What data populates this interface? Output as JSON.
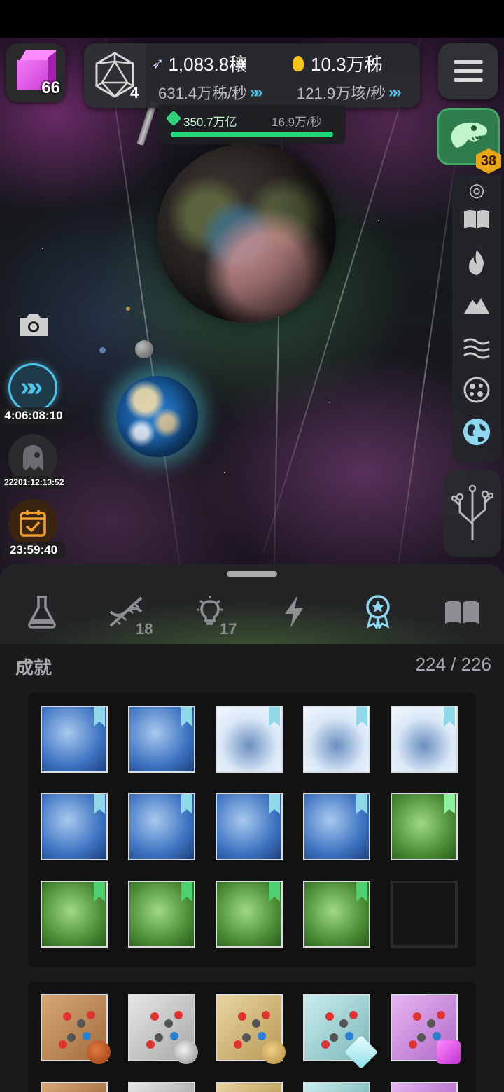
{
  "hud": {
    "gem_count": "66",
    "d20_level": "4",
    "resource_a": {
      "value": "1,083.8穰",
      "rate": "631.4万秭/秒"
    },
    "resource_b": {
      "value": "10.3万秭",
      "rate": "121.9万垓/秒"
    },
    "biomass": {
      "value": "350.7万亿",
      "rate": "16.9万/秒",
      "progress_pct": 100
    },
    "dino_badge": "38"
  },
  "left_timers": {
    "boost": "4:06:08:10",
    "ghost": "22201:12:13:52",
    "calendar": "23:59:40"
  },
  "tabs": [
    {
      "name": "flask",
      "count": ""
    },
    {
      "name": "dna",
      "count": "18"
    },
    {
      "name": "idea",
      "count": "17"
    },
    {
      "name": "bolt",
      "count": ""
    },
    {
      "name": "achievements",
      "count": ""
    },
    {
      "name": "book",
      "count": ""
    }
  ],
  "achievements": {
    "title": "成就",
    "count": "224 / 226"
  },
  "colors": {
    "accent_blue": "#4fc3e8",
    "bio_green": "#1fd67a",
    "badge_orange": "#e8a61b",
    "active_tab": "#8fd6f0"
  },
  "icons": [
    "gem-cube-icon",
    "d20-icon",
    "rocket-icon",
    "bulb-icon",
    "leaf-icon",
    "menu-icon",
    "dino-icon",
    "camera-icon",
    "fast-forward-icon",
    "ghost-icon",
    "calendar-icon",
    "book-icon",
    "fire-icon",
    "mountain-icon",
    "waves-icon",
    "cells-icon",
    "globe-icon",
    "tree-icon",
    "flask-icon",
    "dna-icon",
    "bulb-icon",
    "bolt-icon",
    "award-icon"
  ]
}
